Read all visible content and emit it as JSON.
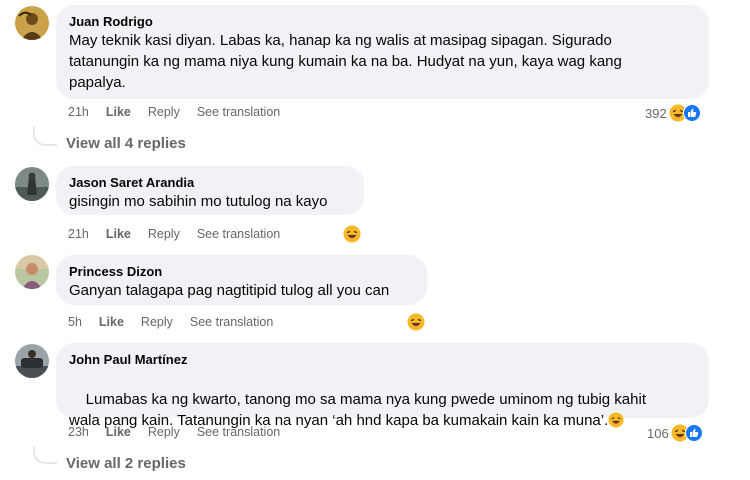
{
  "comments": [
    {
      "author": "Juan Rodrigo",
      "text": "May teknik kasi diyan. Labas ka, hanap ka ng walis at masipag sipagan. Sigurado\ntatanungin ka ng mama niya kung kumain ka na ba. Hudyat na yun, kaya wag kang\npapalya.",
      "time": "21h",
      "like": "Like",
      "reply": "Reply",
      "translate": "See translation",
      "reaction_count": "392",
      "reactions": [
        "haha-emoji",
        "like-emoji"
      ],
      "view_replies": "View all 4 replies"
    },
    {
      "author": "Jason Saret Arandia",
      "text": "gisingin mo sabihin mo tutulog na kayo",
      "time": "21h",
      "like": "Like",
      "reply": "Reply",
      "translate": "See translation",
      "reactions": [
        "haha-emoji"
      ]
    },
    {
      "author": "Princess Dizon",
      "text": "Ganyan talagapa pag nagtitipid tulog all you can",
      "time": "5h",
      "like": "Like",
      "reply": "Reply",
      "translate": "See translation",
      "reactions": [
        "haha-emoji"
      ]
    },
    {
      "author": "John Paul Martínez",
      "text": "Lumabas ka ng kwarto, tanong mo sa mama nya kung pwede uminom ng tubig kahit\nwala pang kain. Tatanungin ka na nyan ‘ah hnd kapa ba kumakain kain ka muna’.",
      "time": "23h",
      "like": "Like",
      "reply": "Reply",
      "translate": "See translation",
      "reaction_count": "106",
      "reactions": [
        "haha-emoji",
        "like-emoji"
      ],
      "view_replies": "View all 2 replies"
    }
  ],
  "colors": {
    "bubble": "#f0f2f5",
    "meta_text": "#65676b",
    "like_blue": "#1877f2",
    "haha_yellow": "#f7b928"
  }
}
